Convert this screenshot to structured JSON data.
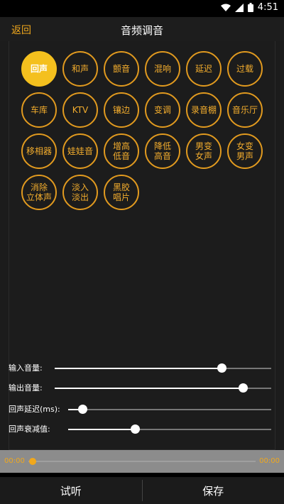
{
  "status": {
    "time": "4:51"
  },
  "appbar": {
    "back_label": "返回",
    "title": "音频调音"
  },
  "effects": [
    {
      "label": "回声",
      "active": true
    },
    {
      "label": "和声"
    },
    {
      "label": "颤音"
    },
    {
      "label": "混响"
    },
    {
      "label": "延迟"
    },
    {
      "label": "过载"
    },
    {
      "label": "车库"
    },
    {
      "label": "KTV"
    },
    {
      "label": "镶边"
    },
    {
      "label": "变调"
    },
    {
      "label": "录音棚"
    },
    {
      "label": "音乐厅"
    },
    {
      "label": "移相器"
    },
    {
      "label": "娃娃音"
    },
    {
      "label": "增高\n低音"
    },
    {
      "label": "降低\n高音"
    },
    {
      "label": "男变\n女声"
    },
    {
      "label": "女变\n男声"
    },
    {
      "label": "消除\n立体声"
    },
    {
      "label": "淡入\n淡出"
    },
    {
      "label": "黑胶\n唱片"
    }
  ],
  "sliders": {
    "input_volume": {
      "label": "输入音量:",
      "value": 0.77
    },
    "output_volume": {
      "label": "输出音量:",
      "value": 0.87
    },
    "echo_delay": {
      "label": "回声延迟(ms):",
      "value": 0.07
    },
    "echo_decay": {
      "label": "回声衰减值:",
      "value": 0.33
    }
  },
  "player": {
    "current_time": "00:00",
    "total_time": "00:00",
    "progress": 0.0
  },
  "bottom": {
    "preview_label": "试听",
    "save_label": "保存"
  },
  "colors": {
    "accent": "#f1a81c",
    "active_fill": "#f4c01e"
  }
}
